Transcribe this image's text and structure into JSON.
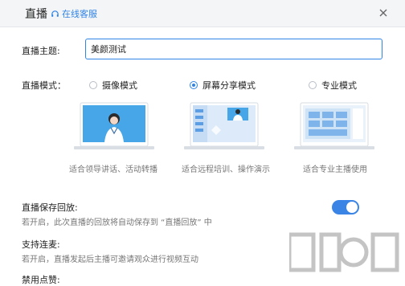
{
  "header": {
    "title": "直播",
    "support_label": "在线客服"
  },
  "topic": {
    "label": "直播主题:",
    "value": "美颜测试"
  },
  "mode": {
    "label": "直播模式：",
    "options": [
      {
        "label": "摄像模式",
        "selected": false,
        "caption": "适合领导讲话、活动转播"
      },
      {
        "label": "屏幕分享模式",
        "selected": true,
        "caption": "适合远程培训、操作演示"
      },
      {
        "label": "专业模式",
        "selected": false,
        "caption": "适合专业主播使用"
      }
    ]
  },
  "settings": [
    {
      "title": "直播保存回放:",
      "desc": "若开启，此次直播的回放将自动保存到 “直播回放” 中",
      "toggle_on": true
    },
    {
      "title": "支持连麦:",
      "desc": "若开启，直播发起后主播可邀请观众进行视频互动"
    },
    {
      "title": "禁用点赞:"
    }
  ],
  "colors": {
    "accent": "#2f84e6",
    "header_bg": "#f4f5f7"
  }
}
